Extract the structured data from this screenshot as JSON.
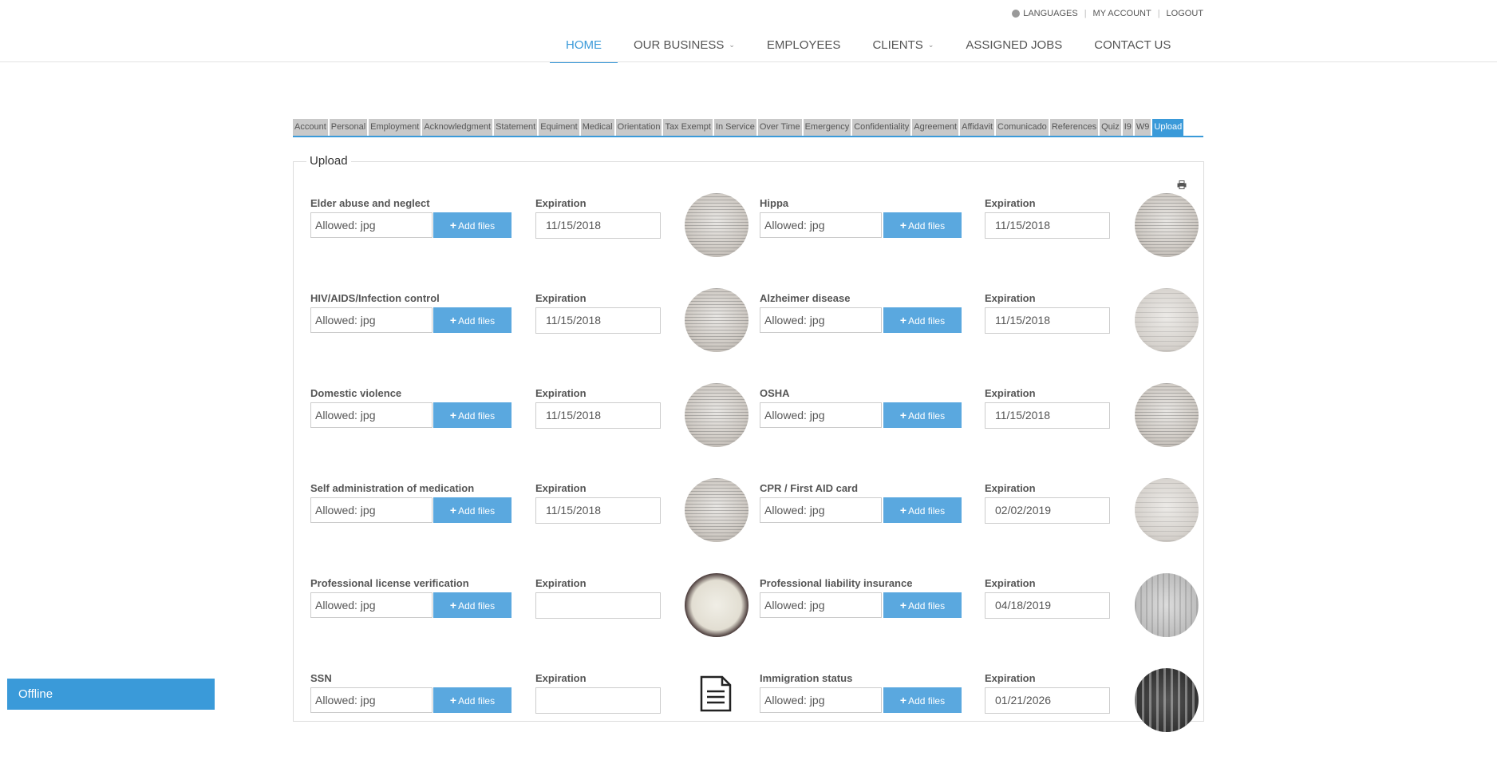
{
  "topbar": {
    "languages": "LANGUAGES",
    "my_account": "MY ACCOUNT",
    "logout": "LOGOUT"
  },
  "nav": {
    "home": "HOME",
    "our_business": "OUR BUSINESS",
    "employees": "EMPLOYEES",
    "clients": "CLIENTS",
    "assigned_jobs": "ASSIGNED JOBS",
    "contact_us": "CONTACT US"
  },
  "tabs": [
    "Account",
    "Personal",
    "Employment",
    "Acknowledgment",
    "Statement",
    "Equiment",
    "Medical",
    "Orientation",
    "Tax Exempt",
    "In Service",
    "Over Time",
    "Emergency",
    "Confidentiality",
    "Agreement",
    "Affidavit",
    "Comunicado",
    "References",
    "Quiz",
    "I9",
    "W9",
    "Upload"
  ],
  "active_tab": "Upload",
  "section_title": "Upload",
  "common": {
    "placeholder": "Allowed: jpg",
    "add_files": "Add files",
    "expiration": "Expiration"
  },
  "documents": [
    {
      "label": "Elder abuse and neglect",
      "expiration": "11/15/2018",
      "thumb": "doc"
    },
    {
      "label": "Hippa",
      "expiration": "11/15/2018",
      "thumb": "doc"
    },
    {
      "label": "HIV/AIDS/Infection control",
      "expiration": "11/15/2018",
      "thumb": "doc"
    },
    {
      "label": "Alzheimer disease",
      "expiration": "11/15/2018",
      "thumb": "doc2"
    },
    {
      "label": "Domestic violence",
      "expiration": "11/15/2018",
      "thumb": "doc"
    },
    {
      "label": "OSHA",
      "expiration": "11/15/2018",
      "thumb": "doc"
    },
    {
      "label": "Self administration of medication",
      "expiration": "11/15/2018",
      "thumb": "doc"
    },
    {
      "label": "CPR / First AID card",
      "expiration": "02/02/2019",
      "thumb": "doc2"
    },
    {
      "label": "Professional license verification",
      "expiration": "",
      "thumb": "cert"
    },
    {
      "label": "Professional liability insurance",
      "expiration": "04/18/2019",
      "thumb": "ins"
    },
    {
      "label": "SSN",
      "expiration": "",
      "thumb": "file"
    },
    {
      "label": "Immigration status",
      "expiration": "01/21/2026",
      "thumb": "dark"
    }
  ],
  "chat": {
    "status": "Offline"
  }
}
